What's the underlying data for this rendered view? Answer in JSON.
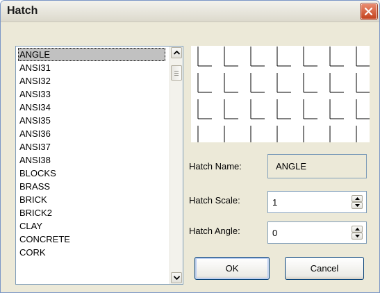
{
  "window": {
    "title": "Hatch"
  },
  "patterns": {
    "items": [
      "ANGLE",
      "ANSI31",
      "ANSI32",
      "ANSI33",
      "ANSI34",
      "ANSI35",
      "ANSI36",
      "ANSI37",
      "ANSI38",
      "BLOCKS",
      "BRASS",
      "BRICK",
      "BRICK2",
      "CLAY",
      "CONCRETE",
      "CORK"
    ],
    "selected": "ANGLE"
  },
  "hatch_name": {
    "label": "Hatch Name:",
    "value": "ANGLE"
  },
  "hatch_scale": {
    "label": "Hatch Scale:",
    "value": "1"
  },
  "hatch_angle": {
    "label": "Hatch Angle:",
    "value": "0"
  },
  "buttons": {
    "ok": "OK",
    "cancel": "Cancel"
  },
  "colors": {
    "close_button": "#d9572f",
    "selection": "#c1c1c1",
    "dialog_bg": "#ece9d8"
  },
  "icons": {
    "close": "close-icon",
    "scroll_up": "chevron-up-icon",
    "scroll_down": "chevron-down-icon"
  }
}
